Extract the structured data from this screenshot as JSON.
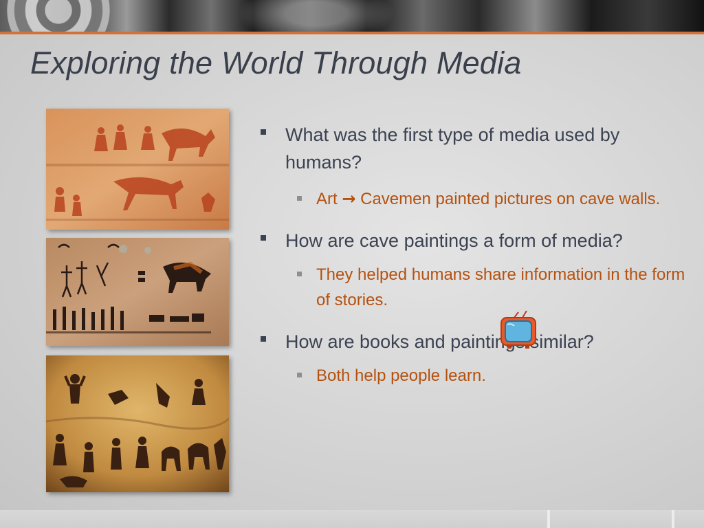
{
  "slide": {
    "title": "Exploring the World Through Media"
  },
  "bullets": [
    {
      "text": "What was the first type of media used by humans?",
      "sub": {
        "before": "Art ",
        "arrow": "→",
        "after": " Cavemen painted pictures on cave walls."
      }
    },
    {
      "text": "How are cave paintings a form of media?",
      "sub": {
        "text": "They helped humans share information in the form of stories."
      }
    },
    {
      "text": "How are books and paintings similar?",
      "sub": {
        "text": "Both help people learn."
      }
    }
  ],
  "images": [
    {
      "name": "cave-painting-red-figures",
      "icon": "cave-art-image"
    },
    {
      "name": "cave-painting-black-figures",
      "icon": "cave-art-image"
    },
    {
      "name": "cave-painting-dark-hunters",
      "icon": "cave-art-image"
    }
  ],
  "icons": {
    "tv": "television-icon"
  },
  "colors": {
    "title": "#3a3f4c",
    "body_text": "#3b4252",
    "sub_text": "#b5510f",
    "accent_line": "#d4703a"
  }
}
